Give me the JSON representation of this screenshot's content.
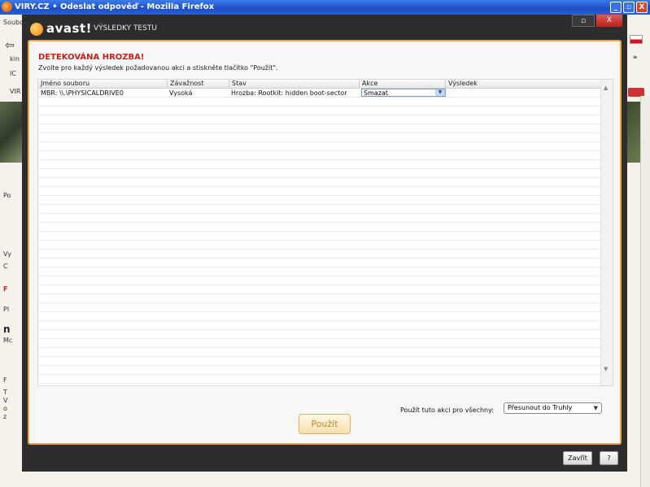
{
  "firefox": {
    "title": "VIRY.CZ • Odeslat odpověď - Mozilla Firefox",
    "minimize": "_",
    "maximize": "▫",
    "close": "X",
    "left_fragments": [
      "Soubo",
      "kin",
      "IC",
      "VIR",
      "Po",
      "Vy",
      "C",
      "F",
      "Pl",
      "n",
      "Mc",
      "F",
      "T",
      "V",
      "o",
      "z"
    ]
  },
  "avast": {
    "logo": "avast!",
    "window_title": "VÝSLEDKY TESTU",
    "minimize": "▫",
    "close": "X",
    "heading": "DETEKOVÁNA HROZBA!",
    "instruction": "Zvolte pro každý výsledek požadovanou akci a stiskněte tlačítko \"Použít\".",
    "columns": [
      "Jméno souboru",
      "Závažnost",
      "Stav",
      "Akce",
      "Výsledek"
    ],
    "rows": [
      {
        "file": "MBR: \\\\.\\PHYSICALDRIVE0",
        "severity": "Vysoká",
        "status": "Hrozba: Rootkit: hidden boot-sector",
        "action": "Smazat",
        "result": ""
      }
    ],
    "apply_all_label": "Použít tuto akci pro všechny:",
    "apply_all_value": "Přesunout do Truhly",
    "apply_button": "Použít",
    "close_button": "Zavřít",
    "help_button": "?"
  }
}
